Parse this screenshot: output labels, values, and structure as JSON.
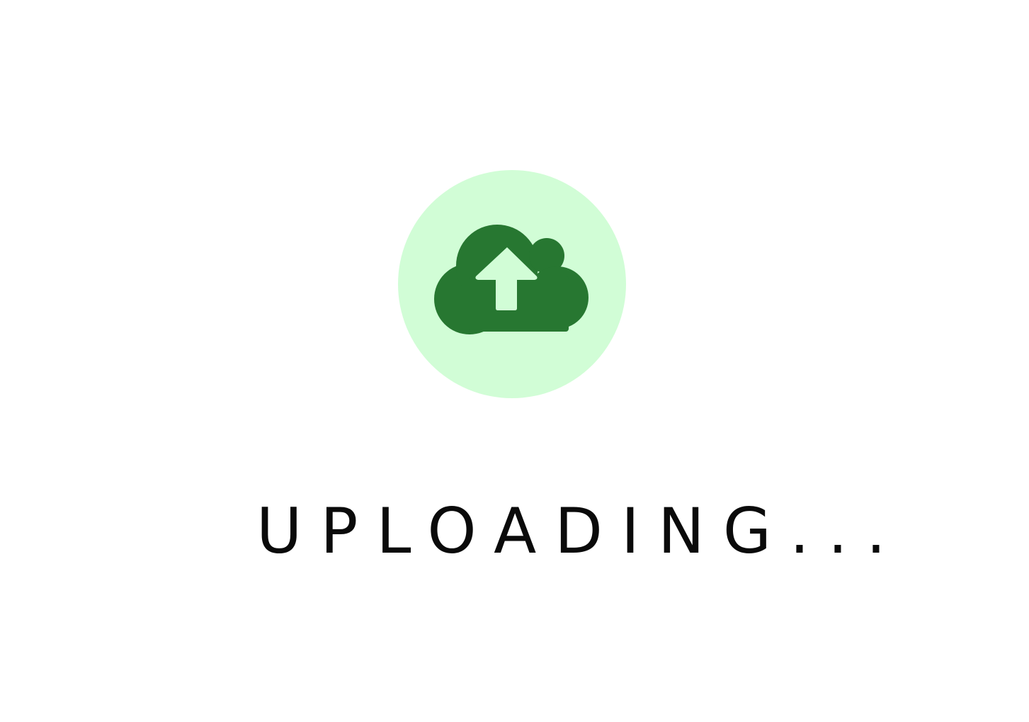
{
  "status": {
    "text": "UPLOADING..."
  },
  "icon": {
    "name": "cloud-upload-icon",
    "badge_color": "#d1fdd6",
    "cloud_color": "#277731",
    "arrow_color": "#d1fdd6"
  }
}
